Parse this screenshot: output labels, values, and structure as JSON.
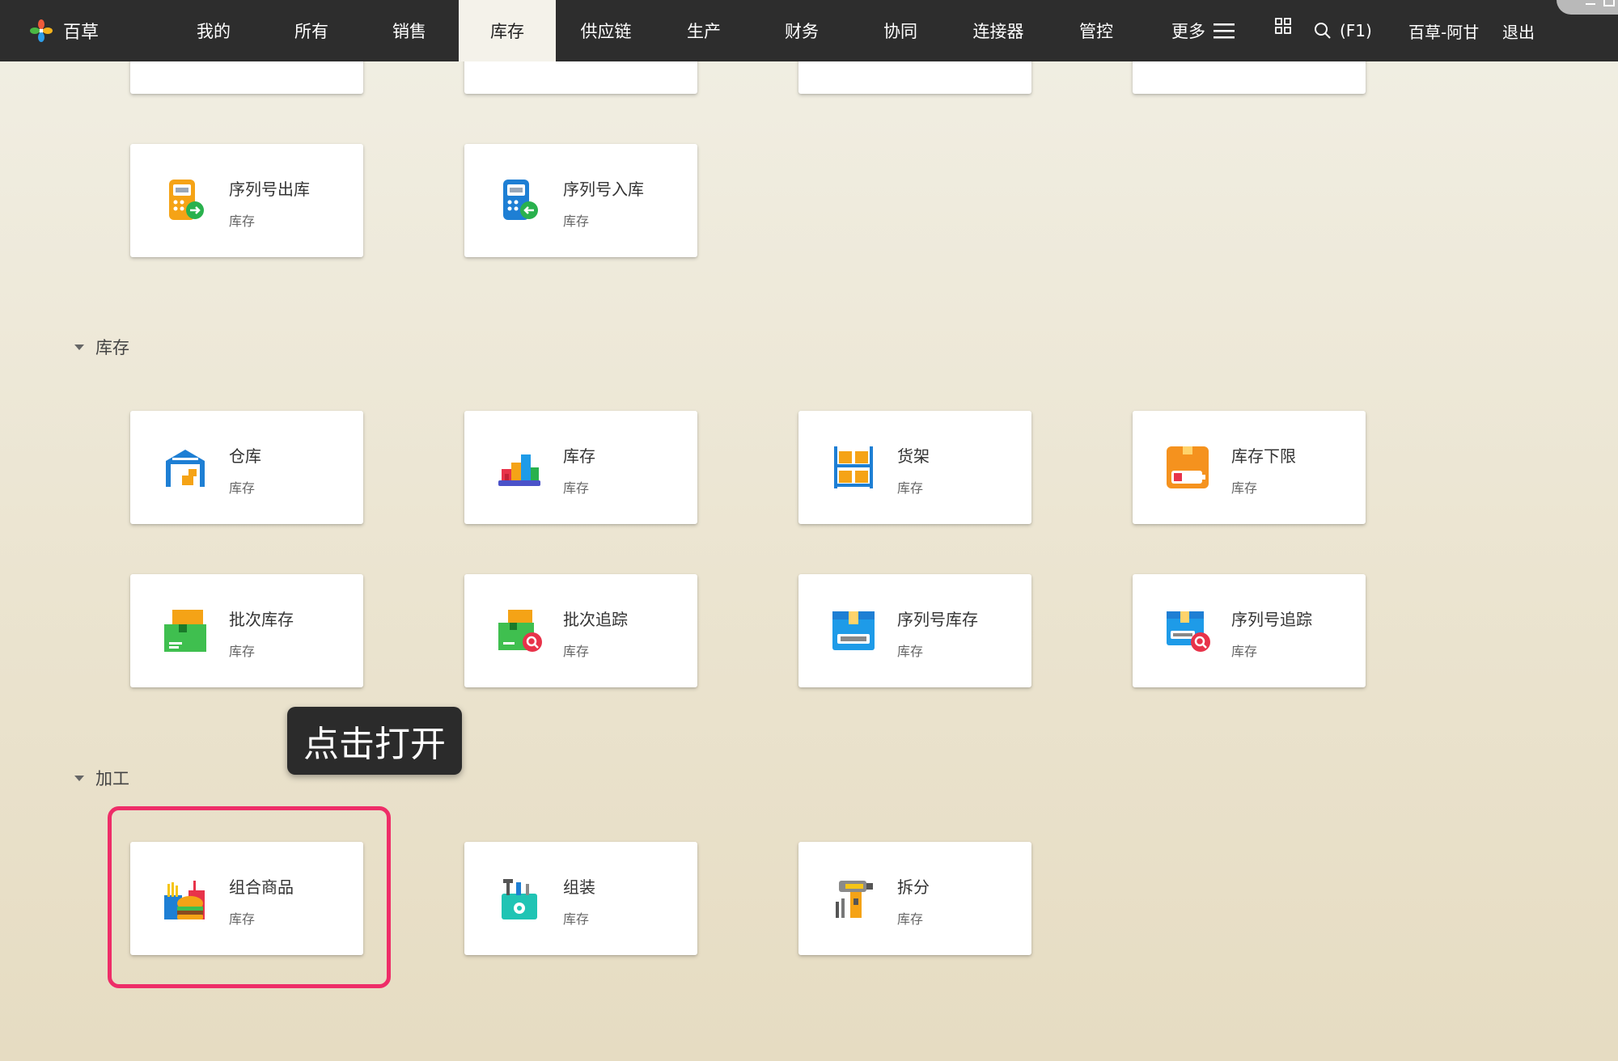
{
  "app": {
    "name": "百草"
  },
  "nav": {
    "items": [
      "我的",
      "所有",
      "销售",
      "库存",
      "供应链",
      "生产",
      "财务",
      "协同",
      "连接器",
      "管控"
    ],
    "active_index": 3,
    "more_label": "更多",
    "search_label": "(F1)",
    "user_label": "百草-阿甘",
    "logout_label": "退出"
  },
  "top_partial_cards": 4,
  "serial_cards": [
    {
      "title": "序列号出库",
      "sub": "库存",
      "icon": "serial-outbound-icon"
    },
    {
      "title": "序列号入库",
      "sub": "库存",
      "icon": "serial-inbound-icon"
    }
  ],
  "sections": {
    "inventory": {
      "title": "库存",
      "cards": [
        {
          "title": "仓库",
          "sub": "库存",
          "icon": "warehouse-icon"
        },
        {
          "title": "库存",
          "sub": "库存",
          "icon": "stock-icon"
        },
        {
          "title": "货架",
          "sub": "库存",
          "icon": "shelf-icon"
        },
        {
          "title": "库存下限",
          "sub": "库存",
          "icon": "stock-minimum-icon"
        },
        {
          "title": "批次库存",
          "sub": "库存",
          "icon": "batch-stock-icon"
        },
        {
          "title": "批次追踪",
          "sub": "库存",
          "icon": "batch-trace-icon"
        },
        {
          "title": "序列号库存",
          "sub": "库存",
          "icon": "serial-stock-icon"
        },
        {
          "title": "序列号追踪",
          "sub": "库存",
          "icon": "serial-trace-icon"
        }
      ]
    },
    "processing": {
      "title": "加工",
      "cards": [
        {
          "title": "组合商品",
          "sub": "库存",
          "icon": "combo-product-icon"
        },
        {
          "title": "组装",
          "sub": "库存",
          "icon": "assembly-icon"
        },
        {
          "title": "拆分",
          "sub": "库存",
          "icon": "split-icon"
        }
      ]
    }
  },
  "tooltip": {
    "text": "点击打开"
  },
  "colors": {
    "nav_bg": "#2d2d2d",
    "highlight": "#ee2d68",
    "tooltip_bg": "#2b2b2b"
  }
}
